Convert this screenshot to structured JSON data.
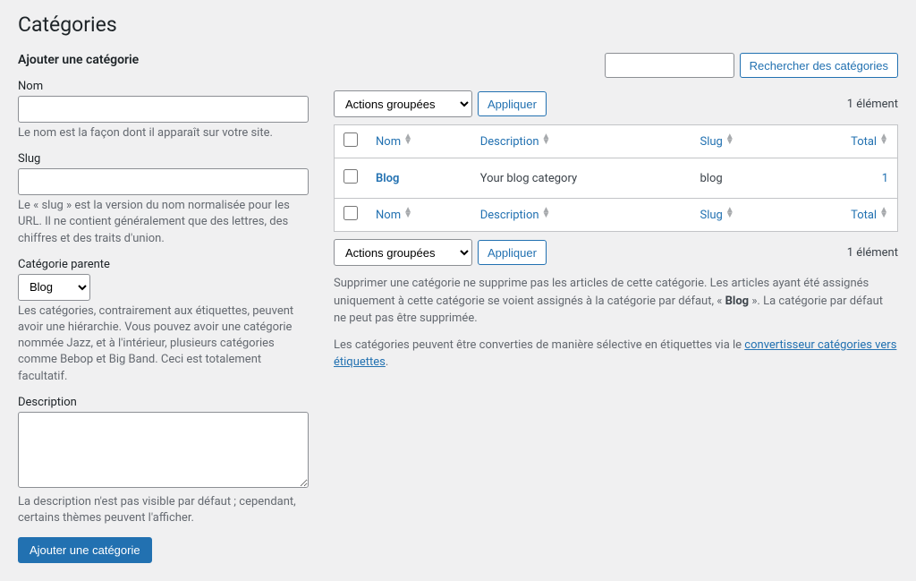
{
  "page_title": "Catégories",
  "search": {
    "button": "Rechercher des catégories"
  },
  "form": {
    "heading": "Ajouter une catégorie",
    "name": {
      "label": "Nom",
      "help": "Le nom est la façon dont il apparaît sur votre site."
    },
    "slug": {
      "label": "Slug",
      "help": "Le « slug » est la version du nom normalisée pour les URL. Il ne contient généralement que des lettres, des chiffres et des traits d'union."
    },
    "parent": {
      "label": "Catégorie parente",
      "selected": "Blog",
      "help": "Les catégories, contrairement aux étiquettes, peuvent avoir une hiérarchie. Vous pouvez avoir une catégorie nommée Jazz, et à l'intérieur, plusieurs catégories comme Bebop et Big Band. Ceci est totalement facultatif."
    },
    "description": {
      "label": "Description",
      "help": "La description n'est pas visible par défaut ; cependant, certains thèmes peuvent l'afficher."
    },
    "submit": "Ajouter une catégorie"
  },
  "bulk": {
    "select": "Actions groupées",
    "apply": "Appliquer"
  },
  "count": "1 élément",
  "columns": {
    "name": "Nom",
    "description": "Description",
    "slug": "Slug",
    "total": "Total"
  },
  "rows": [
    {
      "name": "Blog",
      "description": "Your blog category",
      "slug": "blog",
      "total": "1"
    }
  ],
  "notes": {
    "delete_prefix": "Supprimer une catégorie ne supprime pas les articles de cette catégorie. Les articles ayant été assignés uniquement à cette catégorie se voient assignés à la catégorie par défaut, « ",
    "default_cat": "Blog",
    "delete_suffix": " ». La catégorie par défaut ne peut pas être supprimée.",
    "convert_prefix": "Les catégories peuvent être converties de manière sélective en étiquettes via le ",
    "convert_link": "convertisseur catégories vers étiquettes",
    "convert_suffix": "."
  }
}
